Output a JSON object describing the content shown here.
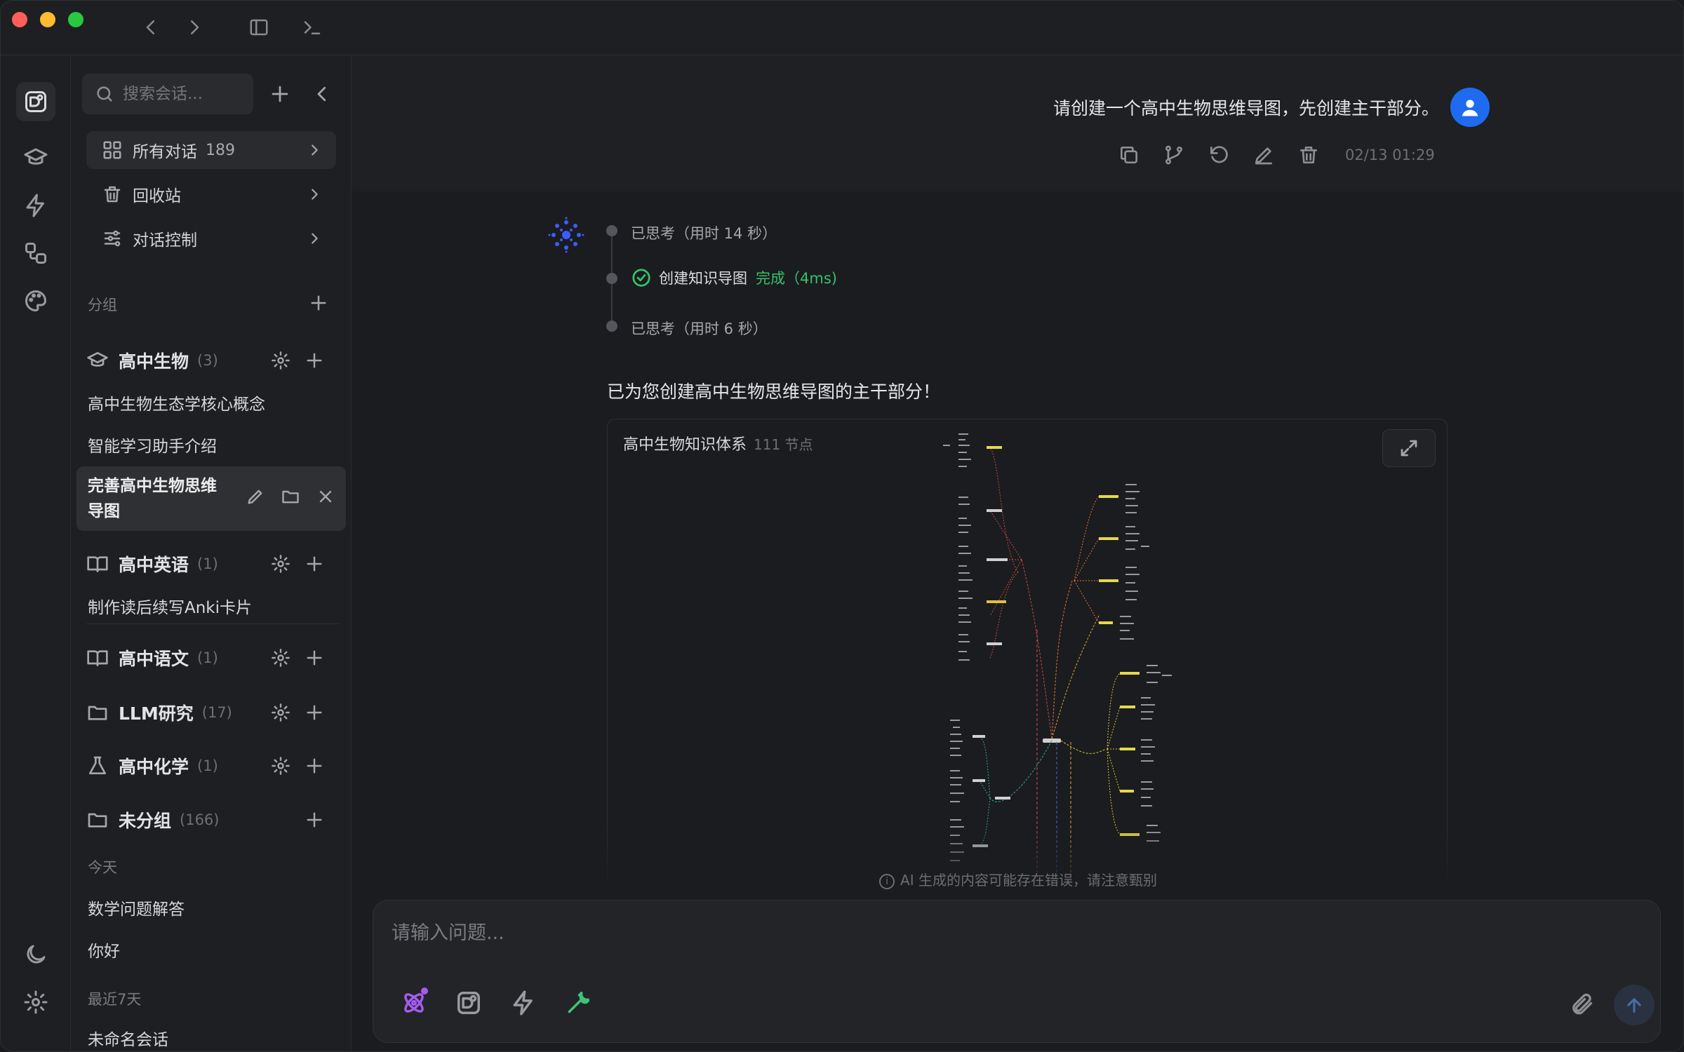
{
  "colors": {
    "close": "#ff5f57",
    "minimize": "#febc2e",
    "zoom": "#28c840",
    "accent": "#1e6bf0",
    "success": "#35c26a",
    "tool_purple": "#a35cf0",
    "tool_green": "#3dc37a"
  },
  "sidebar": {
    "search_placeholder": "搜索会话...",
    "menu": [
      {
        "label": "所有对话",
        "count": "189"
      },
      {
        "label": "回收站"
      },
      {
        "label": "对话控制"
      }
    ],
    "groups_label": "分组",
    "groups": [
      {
        "name": "高中生物",
        "count": "(3)"
      },
      {
        "name": "高中英语",
        "count": "(1)"
      },
      {
        "name": "高中语文",
        "count": "(1)"
      },
      {
        "name": "LLM研究",
        "count": "(17)"
      },
      {
        "name": "高中化学",
        "count": "(1)"
      },
      {
        "name": "未分组",
        "count": "(166)"
      }
    ],
    "bio_conversations": [
      "高中生物生态学核心概念",
      "智能学习助手介绍"
    ],
    "active_conversation": "完善高中生物思维导图",
    "english_conversations": [
      "制作读后续写Anki卡片"
    ],
    "today_label": "今天",
    "today": [
      "数学问题解答",
      "你好"
    ],
    "week_label": "最近7天",
    "week": [
      "未命名会话"
    ]
  },
  "chat": {
    "user_message": "请创建一个高中生物思维导图，先创建主干部分。",
    "timestamp": "02/13 01:29",
    "timeline": {
      "think1": "已思考（用时 14 秒）",
      "step_label": "创建知识导图",
      "step_status": "完成（4ms)",
      "think2": "已思考（用时 6 秒）"
    },
    "reply": "已为您创建高中生物思维导图的主干部分！",
    "mindmap": {
      "title": "高中生物知识体系",
      "count": "111 节点"
    },
    "disclaimer": "AI 生成的内容可能存在错误，请注意甄别",
    "input_placeholder": "请输入问题..."
  }
}
